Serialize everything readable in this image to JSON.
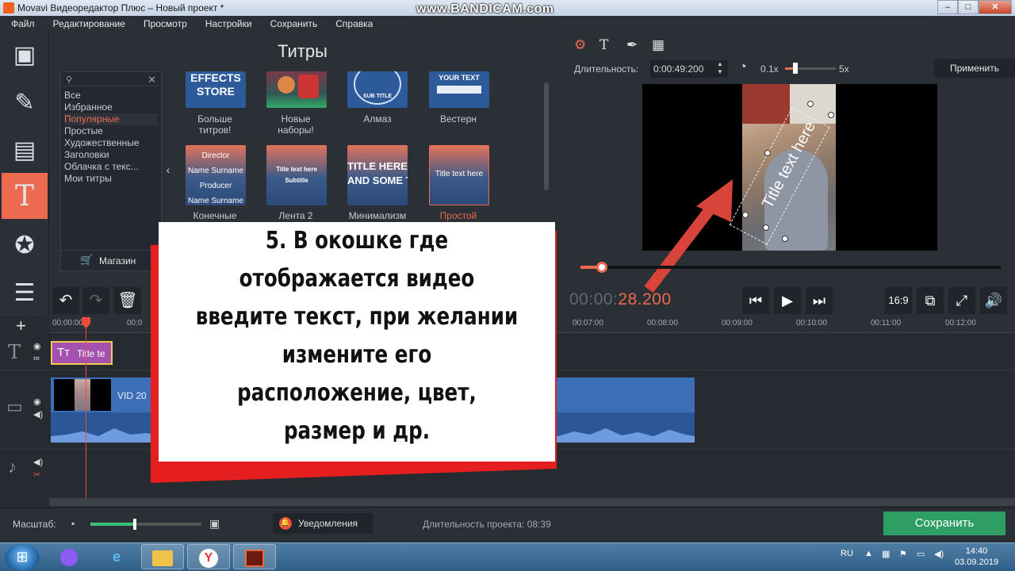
{
  "window": {
    "title": "Movavi Видеоредактор Плюс – Новый проект *",
    "watermark": "www.BANDICAM.com",
    "buttons": [
      "–",
      "□",
      "✕"
    ]
  },
  "menu": [
    "Файл",
    "Редактирование",
    "Просмотр",
    "Настройки",
    "Сохранить",
    "Справка"
  ],
  "sidebar": {
    "tools": [
      {
        "name": "film-icon",
        "glyph": "▣"
      },
      {
        "name": "magic-wand-icon",
        "glyph": "✎"
      },
      {
        "name": "clip-icon",
        "glyph": "▤"
      },
      {
        "name": "text-icon",
        "glyph": "T",
        "active": true
      },
      {
        "name": "star-sticker-icon",
        "glyph": "✪"
      },
      {
        "name": "menu-list-icon",
        "glyph": "☰"
      }
    ]
  },
  "titles_panel": {
    "heading": "Титры",
    "categories": [
      "Все",
      "Избранное",
      "Популярные",
      "Простые",
      "Художественные",
      "Заголовки",
      "Облачка с текс...",
      "Мои титры"
    ],
    "selected_category": "Популярные",
    "store_label": "Магазин",
    "thumbs": [
      {
        "caption": "Больше\nтитров!",
        "text": "EFFECTS\nSTORE"
      },
      {
        "caption": "Новые\nнаборы!",
        "text": ""
      },
      {
        "caption": "Алмаз",
        "text": "SUB TITLE"
      },
      {
        "caption": "Вестерн",
        "text": "YOUR TEXT"
      },
      {
        "caption": "Конечные",
        "text": "Director\nName Surname\nProducer\nName Surname"
      },
      {
        "caption": "Лента 2",
        "text": "Title text here\nSubtitle"
      },
      {
        "caption": "Минимализм",
        "text": "TITLE HERE\nAND SOME TEXT HERE"
      },
      {
        "caption": "Простой",
        "text": "Title text here",
        "selected": true
      }
    ]
  },
  "preview": {
    "duration_label": "Длительность:",
    "duration_value": "0:00:49:200",
    "speed_min": "0.1x",
    "speed_max": "5x",
    "apply_label": "Применить",
    "overlay_text": "Title text here",
    "seek_progress": 0.05,
    "timecode_dim": "00:00:",
    "timecode_hi": "28.200",
    "aspect": "16:9"
  },
  "timeline": {
    "ruler": [
      "00:00:00",
      "00:0",
      "00:07:00",
      "00:08:00",
      "00:09:00",
      "00:10:00",
      "00:11:00",
      "00:12:00"
    ],
    "title_clip": "Title te",
    "video_clip": "VID 20"
  },
  "statusbar": {
    "zoom_label": "Масштаб:",
    "notifications": "Уведомления",
    "project_duration": "Длительность проекта:  08:39",
    "save": "Сохранить"
  },
  "taskbar": {
    "lang": "RU",
    "time": "14:40",
    "date": "03.09.2019"
  },
  "annotation": {
    "lines": [
      "5. В окошке где",
      "отображается видео",
      "введите текст, при желании",
      "измените его",
      "расположение, цвет,",
      "размер и др."
    ]
  },
  "colors": {
    "accent": "#ec6a4f",
    "save_green": "#2e9e64",
    "arrow": "#d9443a"
  }
}
